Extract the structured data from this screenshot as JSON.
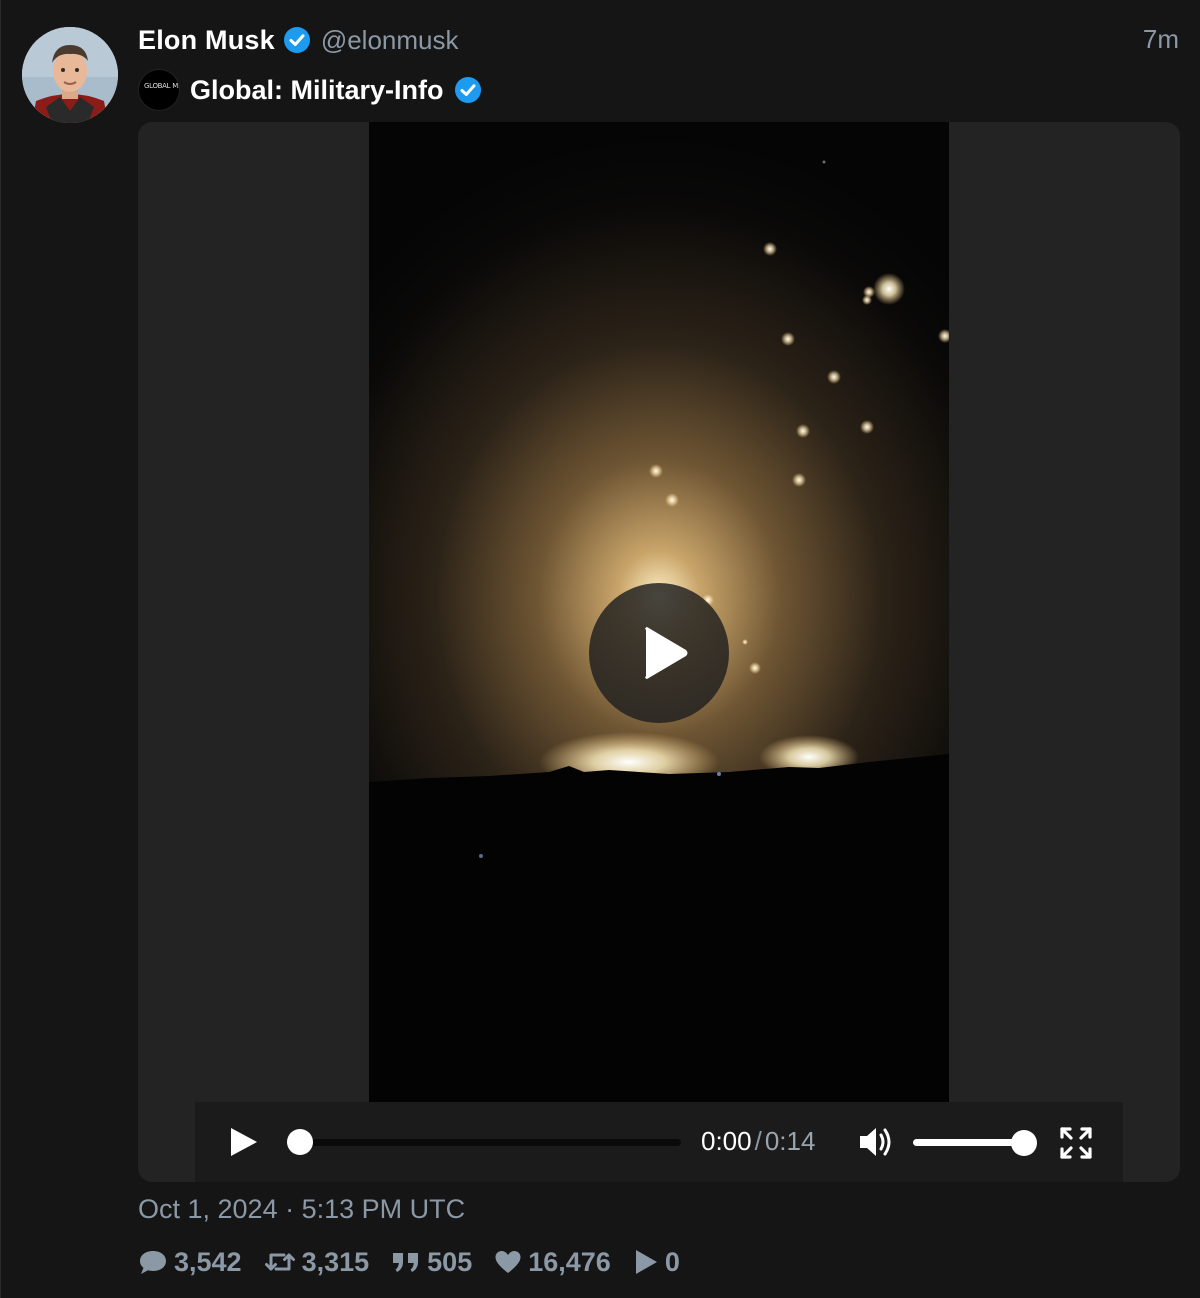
{
  "author": {
    "display_name": "Elon Musk",
    "handle": "@elonmusk",
    "verified": true,
    "time_ago": "7m"
  },
  "quoted": {
    "avatar_text": "GLOBAL MIL INFO",
    "name": "Global: Military-Info",
    "verified": true
  },
  "video": {
    "current_time": "0:00",
    "separator": "/",
    "duration": "0:14",
    "progress_fraction": 0,
    "volume_fraction": 1.0
  },
  "post": {
    "date": "Oct 1, 2024 · 5:13 PM UTC"
  },
  "stats": {
    "comments": "3,542",
    "retweets": "3,315",
    "quotes": "505",
    "likes": "16,476",
    "views": "0"
  },
  "colors": {
    "background": "#151515",
    "verified_blue": "#1d9bf0",
    "muted_text": "#8b98a5"
  },
  "icons": {
    "comment": "comment-icon",
    "retweet": "retweet-icon",
    "quote": "quote-icon",
    "like": "heart-icon",
    "views": "play-icon",
    "volume": "volume-icon",
    "fullscreen": "fullscreen-icon"
  }
}
